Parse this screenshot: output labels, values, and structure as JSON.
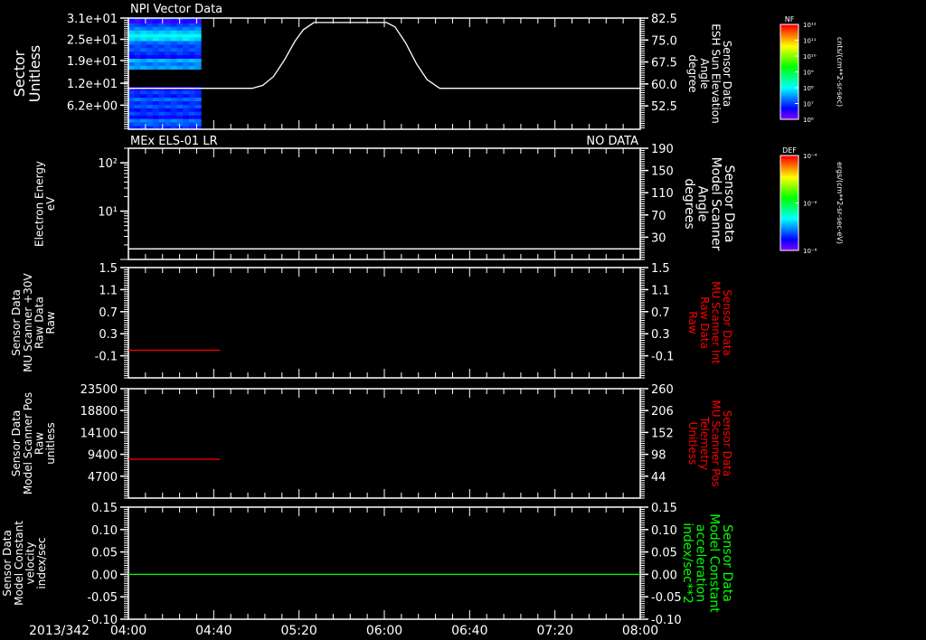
{
  "title": "NPI Vector Data",
  "date_label": "2013/342",
  "time_axis": {
    "start": "04:00",
    "end": "08:00",
    "tick_labels": [
      "04:00",
      "04:40",
      "05:20",
      "06:00",
      "06:40",
      "07:20",
      "08:00"
    ]
  },
  "colorbars": [
    {
      "title": "NF",
      "ticks": [
        "10¹²",
        "10¹¹",
        "10¹⁰",
        "10⁹",
        "10⁸",
        "10⁷",
        "10⁶"
      ],
      "units": "cnts/(cm**2-sr-sec)",
      "log_range": [
        6,
        12
      ]
    },
    {
      "title": "DEF",
      "ticks": [
        "10⁻⁴",
        "10⁻⁶",
        "10⁻⁸"
      ],
      "units": "ergs/(cm**2-sr-sec-eV)",
      "log_range": [
        -8,
        -4
      ]
    }
  ],
  "chart_data": [
    {
      "type": "heatmap",
      "title": "NPI Vector Data",
      "ylabel": [
        "Sector",
        "Unitless"
      ],
      "y_ticks": [
        "3.1e+01",
        "2.5e+01",
        "1.9e+01",
        "1.2e+01",
        "6.2e+00"
      ],
      "y_tick_values": [
        31,
        25,
        19,
        12.6,
        6.4
      ],
      "ylim": [
        -0.4,
        31
      ],
      "x_range": [
        "04:00",
        "04:34"
      ],
      "colorbar": "NF",
      "sector_rows": [
        {
          "sector": 31,
          "log_value": 6.9
        },
        {
          "sector": 30,
          "log_value": 6.4
        },
        {
          "sector": 29,
          "log_value": 7.0
        },
        {
          "sector": 28,
          "log_value": 7.3
        },
        {
          "sector": 27,
          "log_value": 7.7
        },
        {
          "sector": 26,
          "log_value": 8.1
        },
        {
          "sector": 25,
          "log_value": 7.8
        },
        {
          "sector": 24,
          "log_value": 7.2
        },
        {
          "sector": 23,
          "log_value": 7.0
        },
        {
          "sector": 22,
          "log_value": 7.1
        },
        {
          "sector": 21,
          "log_value": 6.9
        },
        {
          "sector": 20,
          "log_value": 6.6
        },
        {
          "sector": 19,
          "log_value": 7.6
        },
        {
          "sector": 18,
          "log_value": 7.3
        },
        {
          "sector": 17,
          "log_value": 7.5
        },
        {
          "sector": 11,
          "log_value": 6.5
        },
        {
          "sector": 10,
          "log_value": 7.0
        },
        {
          "sector": 9,
          "log_value": 6.8
        },
        {
          "sector": 8,
          "log_value": 7.2
        },
        {
          "sector": 7,
          "log_value": 6.9
        },
        {
          "sector": 6,
          "log_value": 7.1
        },
        {
          "sector": 5,
          "log_value": 6.8
        },
        {
          "sector": 4,
          "log_value": 7.0
        },
        {
          "sector": 3,
          "log_value": 6.6
        },
        {
          "sector": 2,
          "log_value": 7.3
        },
        {
          "sector": 1,
          "log_value": 7.1
        },
        {
          "sector": 0,
          "log_value": 6.9
        }
      ],
      "right_axis": {
        "label": [
          "Sensor Data",
          "ESH Sun Elevation",
          "Angle",
          "degree"
        ],
        "ticks": [
          "82.5",
          "75.0",
          "67.5",
          "60.0",
          "52.5"
        ],
        "tick_values": [
          82.5,
          75,
          67.5,
          60,
          52.5
        ],
        "ylim": [
          44.5,
          82.5
        ],
        "label_color": "#ffffff"
      },
      "series": [
        {
          "axis": "right",
          "color": "#ffffff",
          "x": [
            "04:00",
            "04:58",
            "05:03",
            "05:08",
            "05:13",
            "05:18",
            "05:22",
            "05:27",
            "06:01",
            "06:05",
            "06:10",
            "06:15",
            "06:20",
            "06:26",
            "08:00"
          ],
          "y": [
            58.5,
            58.5,
            59.5,
            62.5,
            68,
            74.5,
            78.5,
            81,
            81,
            79.5,
            74,
            67,
            61.5,
            58.5,
            58.5
          ]
        }
      ]
    },
    {
      "type": "line",
      "title": "MEx ELS-01 LR",
      "status": "NO DATA",
      "ylabel": [
        "Electron Energy",
        "eV"
      ],
      "y_scale": "log",
      "y_ticks": [
        "10²",
        "10¹"
      ],
      "y_tick_values": [
        100,
        10
      ],
      "ylim": [
        1,
        200
      ],
      "right_axis": {
        "label": [
          "Sensor Data",
          "Model Scanner",
          "Angle",
          "degrees"
        ],
        "ticks": [
          "190",
          "150",
          "110",
          "70",
          "30"
        ],
        "tick_values": [
          190,
          150,
          110,
          70,
          30
        ],
        "ylim": [
          -10,
          190
        ],
        "label_color": "#ffffff"
      },
      "series": [
        {
          "axis": "right",
          "color": "#ffffff",
          "x": [
            "04:00",
            "08:00"
          ],
          "y": [
            9,
            9
          ]
        }
      ]
    },
    {
      "type": "line",
      "ylabel": [
        "Sensor Data",
        "MU Scanner +30V",
        "Raw Data",
        "Raw"
      ],
      "y_ticks": [
        "1.5",
        "1.1",
        "0.7",
        "0.3",
        "-0.1"
      ],
      "y_tick_values": [
        1.5,
        1.1,
        0.7,
        0.3,
        -0.1
      ],
      "ylim": [
        -0.5,
        1.5
      ],
      "right_axis": {
        "label": [
          "Sensor Data",
          "MU Scanner Int",
          "Raw Data",
          "Raw"
        ],
        "ticks": [
          "1.5",
          "1.1",
          "0.7",
          "0.3",
          "-0.1"
        ],
        "tick_values": [
          1.5,
          1.1,
          0.7,
          0.3,
          -0.1
        ],
        "ylim": [
          -0.5,
          1.5
        ],
        "label_color": "#ff0000"
      },
      "series": [
        {
          "axis": "right",
          "color": "#ff0000",
          "x": [
            "04:00",
            "04:43"
          ],
          "y": [
            0.0,
            0.0
          ]
        }
      ]
    },
    {
      "type": "line",
      "ylabel": [
        "Sensor Data",
        "Model Scanner Pos",
        "Raw",
        "unitless"
      ],
      "y_ticks": [
        "23500",
        "18800",
        "14100",
        "9400",
        "4700"
      ],
      "y_tick_values": [
        23500,
        18800,
        14100,
        9400,
        4700
      ],
      "ylim": [
        0,
        23500
      ],
      "right_axis": {
        "label": [
          "Sensor Data",
          "MU Scanner Pos",
          "Telemetry",
          "Unitless"
        ],
        "ticks": [
          "260",
          "206",
          "152",
          "98",
          "44"
        ],
        "tick_values": [
          260,
          206,
          152,
          98,
          44
        ],
        "ylim": [
          -10,
          260
        ],
        "label_color": "#ff0000"
      },
      "series": [
        {
          "axis": "right",
          "color": "#ff0000",
          "x": [
            "04:00",
            "04:43"
          ],
          "y": [
            86,
            86
          ]
        }
      ]
    },
    {
      "type": "line",
      "ylabel": [
        "Sensor Data",
        "Model Constant",
        "velocity",
        "index/sec"
      ],
      "y_ticks": [
        "0.15",
        "0.10",
        "0.05",
        "0.00",
        "-0.05",
        "-0.10"
      ],
      "y_tick_values": [
        0.15,
        0.1,
        0.05,
        0.0,
        -0.05,
        -0.1
      ],
      "ylim": [
        -0.1,
        0.15
      ],
      "right_axis": {
        "label": [
          "Sensor Data",
          "Model Constant",
          "acceleration",
          "index/sec**2"
        ],
        "ticks": [
          "0.15",
          "0.10",
          "0.05",
          "0.00",
          "-0.05",
          "-0.10"
        ],
        "tick_values": [
          0.15,
          0.1,
          0.05,
          0.0,
          -0.05,
          -0.1
        ],
        "ylim": [
          -0.1,
          0.15
        ],
        "label_color": "#00ff00"
      },
      "series": [
        {
          "axis": "right",
          "color": "#00ff00",
          "x": [
            "04:00",
            "08:00"
          ],
          "y": [
            0,
            0
          ]
        }
      ]
    }
  ]
}
